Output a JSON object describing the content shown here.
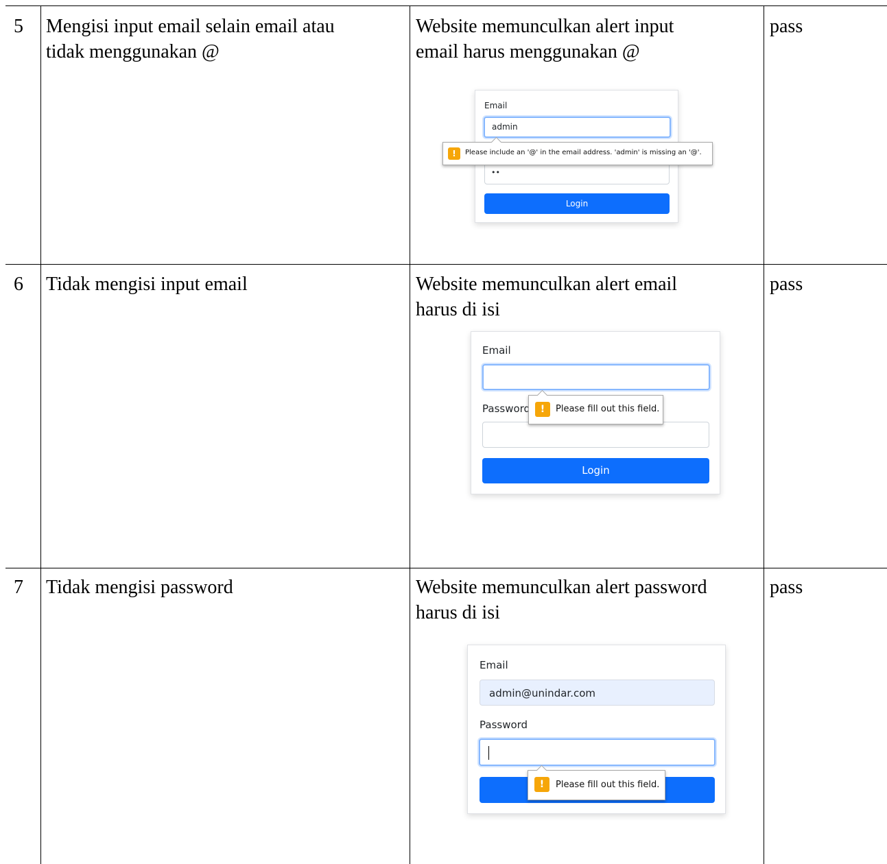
{
  "rows": [
    {
      "no": "5",
      "scenario": "Mengisi input email selain email atau\ntidak menggunakan @",
      "expected": "Website memunculkan alert input\nemail harus menggunakan @",
      "result": "pass",
      "screenshot": {
        "email_label": "Email",
        "email_value": "admin",
        "password_value": "••",
        "tooltip": "Please include an '@' in the email address. 'admin' is missing an '@'.",
        "login_label": "Login"
      }
    },
    {
      "no": "6",
      "scenario": "Tidak mengisi input email",
      "expected": "Website memunculkan alert email\nharus di isi",
      "result": "pass",
      "screenshot": {
        "email_label": "Email",
        "password_label": "Password",
        "tooltip": "Please fill out this field.",
        "login_label": "Login"
      }
    },
    {
      "no": "7",
      "scenario": "Tidak mengisi password",
      "expected": "Website memunculkan alert password\nharus di isi",
      "result": "pass",
      "screenshot": {
        "email_label": "Email",
        "email_value": "admin@unindar.com",
        "password_label": "Password",
        "tooltip": "Please fill out this field."
      }
    }
  ],
  "colors": {
    "button": "#0d6efd",
    "warning": "#f6a609",
    "focus": "#86b7fe"
  },
  "icons": {
    "warning": "exclamation-warning-icon"
  }
}
